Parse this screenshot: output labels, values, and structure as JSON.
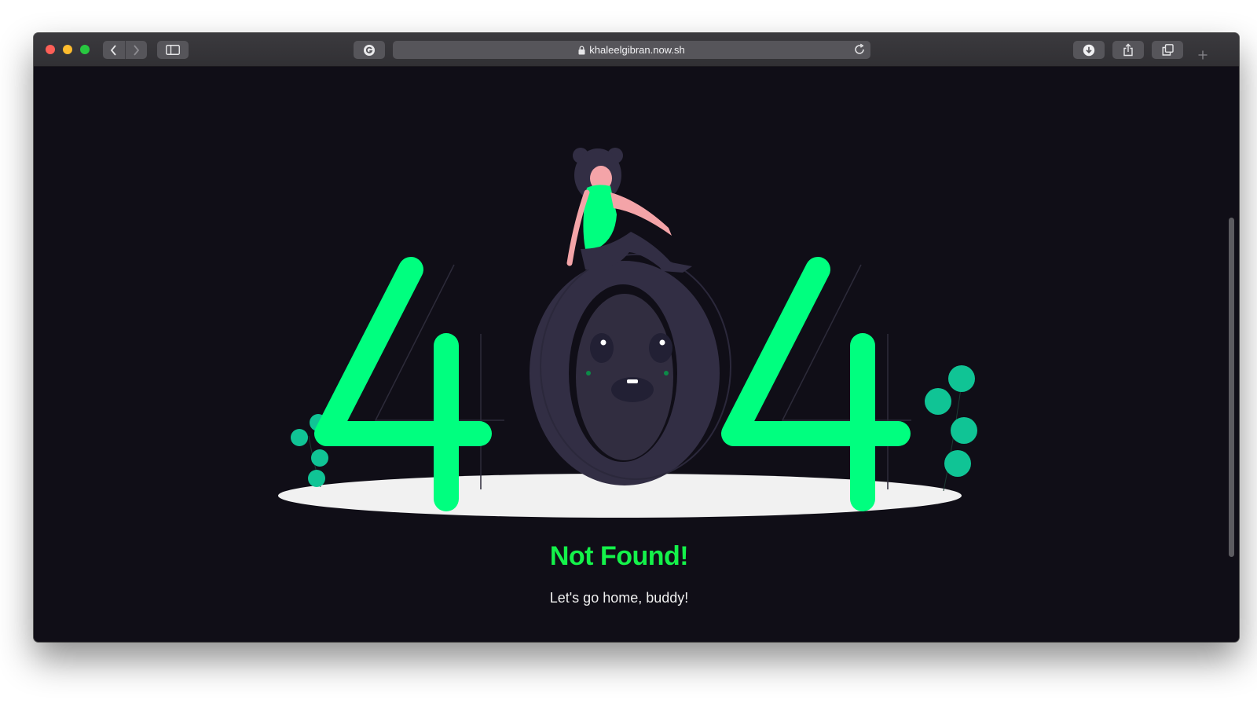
{
  "browser": {
    "url": "khaleelgibran.now.sh"
  },
  "page": {
    "error_code": "404",
    "headline": "Not Found!",
    "subtitle": "Let's go home, buddy!"
  },
  "icons": {
    "back": "chevron-left-icon",
    "forward": "chevron-right-icon",
    "sidebar": "sidebar-icon",
    "extension": "grammarly-icon",
    "lock": "lock-icon",
    "reload": "reload-icon",
    "download": "download-icon",
    "share": "share-icon",
    "tabs": "tabs-icon",
    "new_tab": "plus-icon"
  },
  "colors": {
    "accent_green": "#00ff7f",
    "headline_green": "#14f24a",
    "page_background": "#100e17",
    "leaf_teal": "#10c495"
  }
}
